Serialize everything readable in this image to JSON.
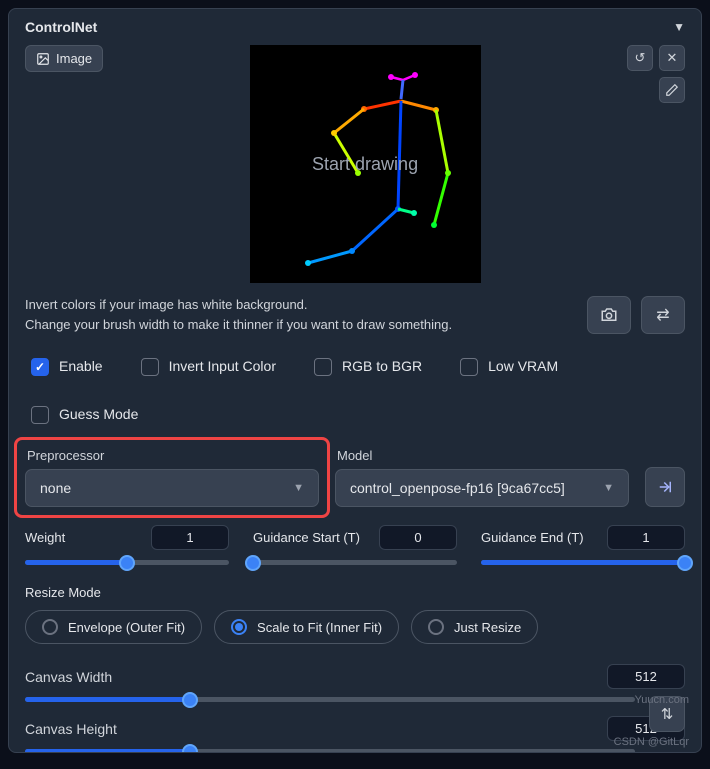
{
  "panel": {
    "title": "ControlNet"
  },
  "imageTab": "Image",
  "canvasText": "Start drawing",
  "hint": {
    "line1": "Invert colors if your image has white background.",
    "line2": "Change your brush width to make it thinner if you want to draw something."
  },
  "checks": {
    "enable": "Enable",
    "invert": "Invert Input Color",
    "rgb": "RGB to BGR",
    "lowvram": "Low VRAM",
    "guess": "Guess Mode"
  },
  "preprocessor": {
    "label": "Preprocessor",
    "value": "none"
  },
  "model": {
    "label": "Model",
    "value": "control_openpose-fp16 [9ca67cc5]"
  },
  "sliders": {
    "weight": {
      "label": "Weight",
      "value": "1",
      "pct": 50
    },
    "gstart": {
      "label": "Guidance Start (T)",
      "value": "0",
      "pct": 0
    },
    "gend": {
      "label": "Guidance End (T)",
      "value": "1",
      "pct": 100
    }
  },
  "resize": {
    "label": "Resize Mode",
    "envelope": "Envelope (Outer Fit)",
    "scale": "Scale to Fit (Inner Fit)",
    "just": "Just Resize"
  },
  "dims": {
    "widthLabel": "Canvas Width",
    "widthValue": "512",
    "widthPct": 27,
    "heightLabel": "Canvas Height",
    "heightValue": "512",
    "heightPct": 27
  },
  "watermark1": "Yuucn.com",
  "watermark2": "CSDN @GitLqr"
}
